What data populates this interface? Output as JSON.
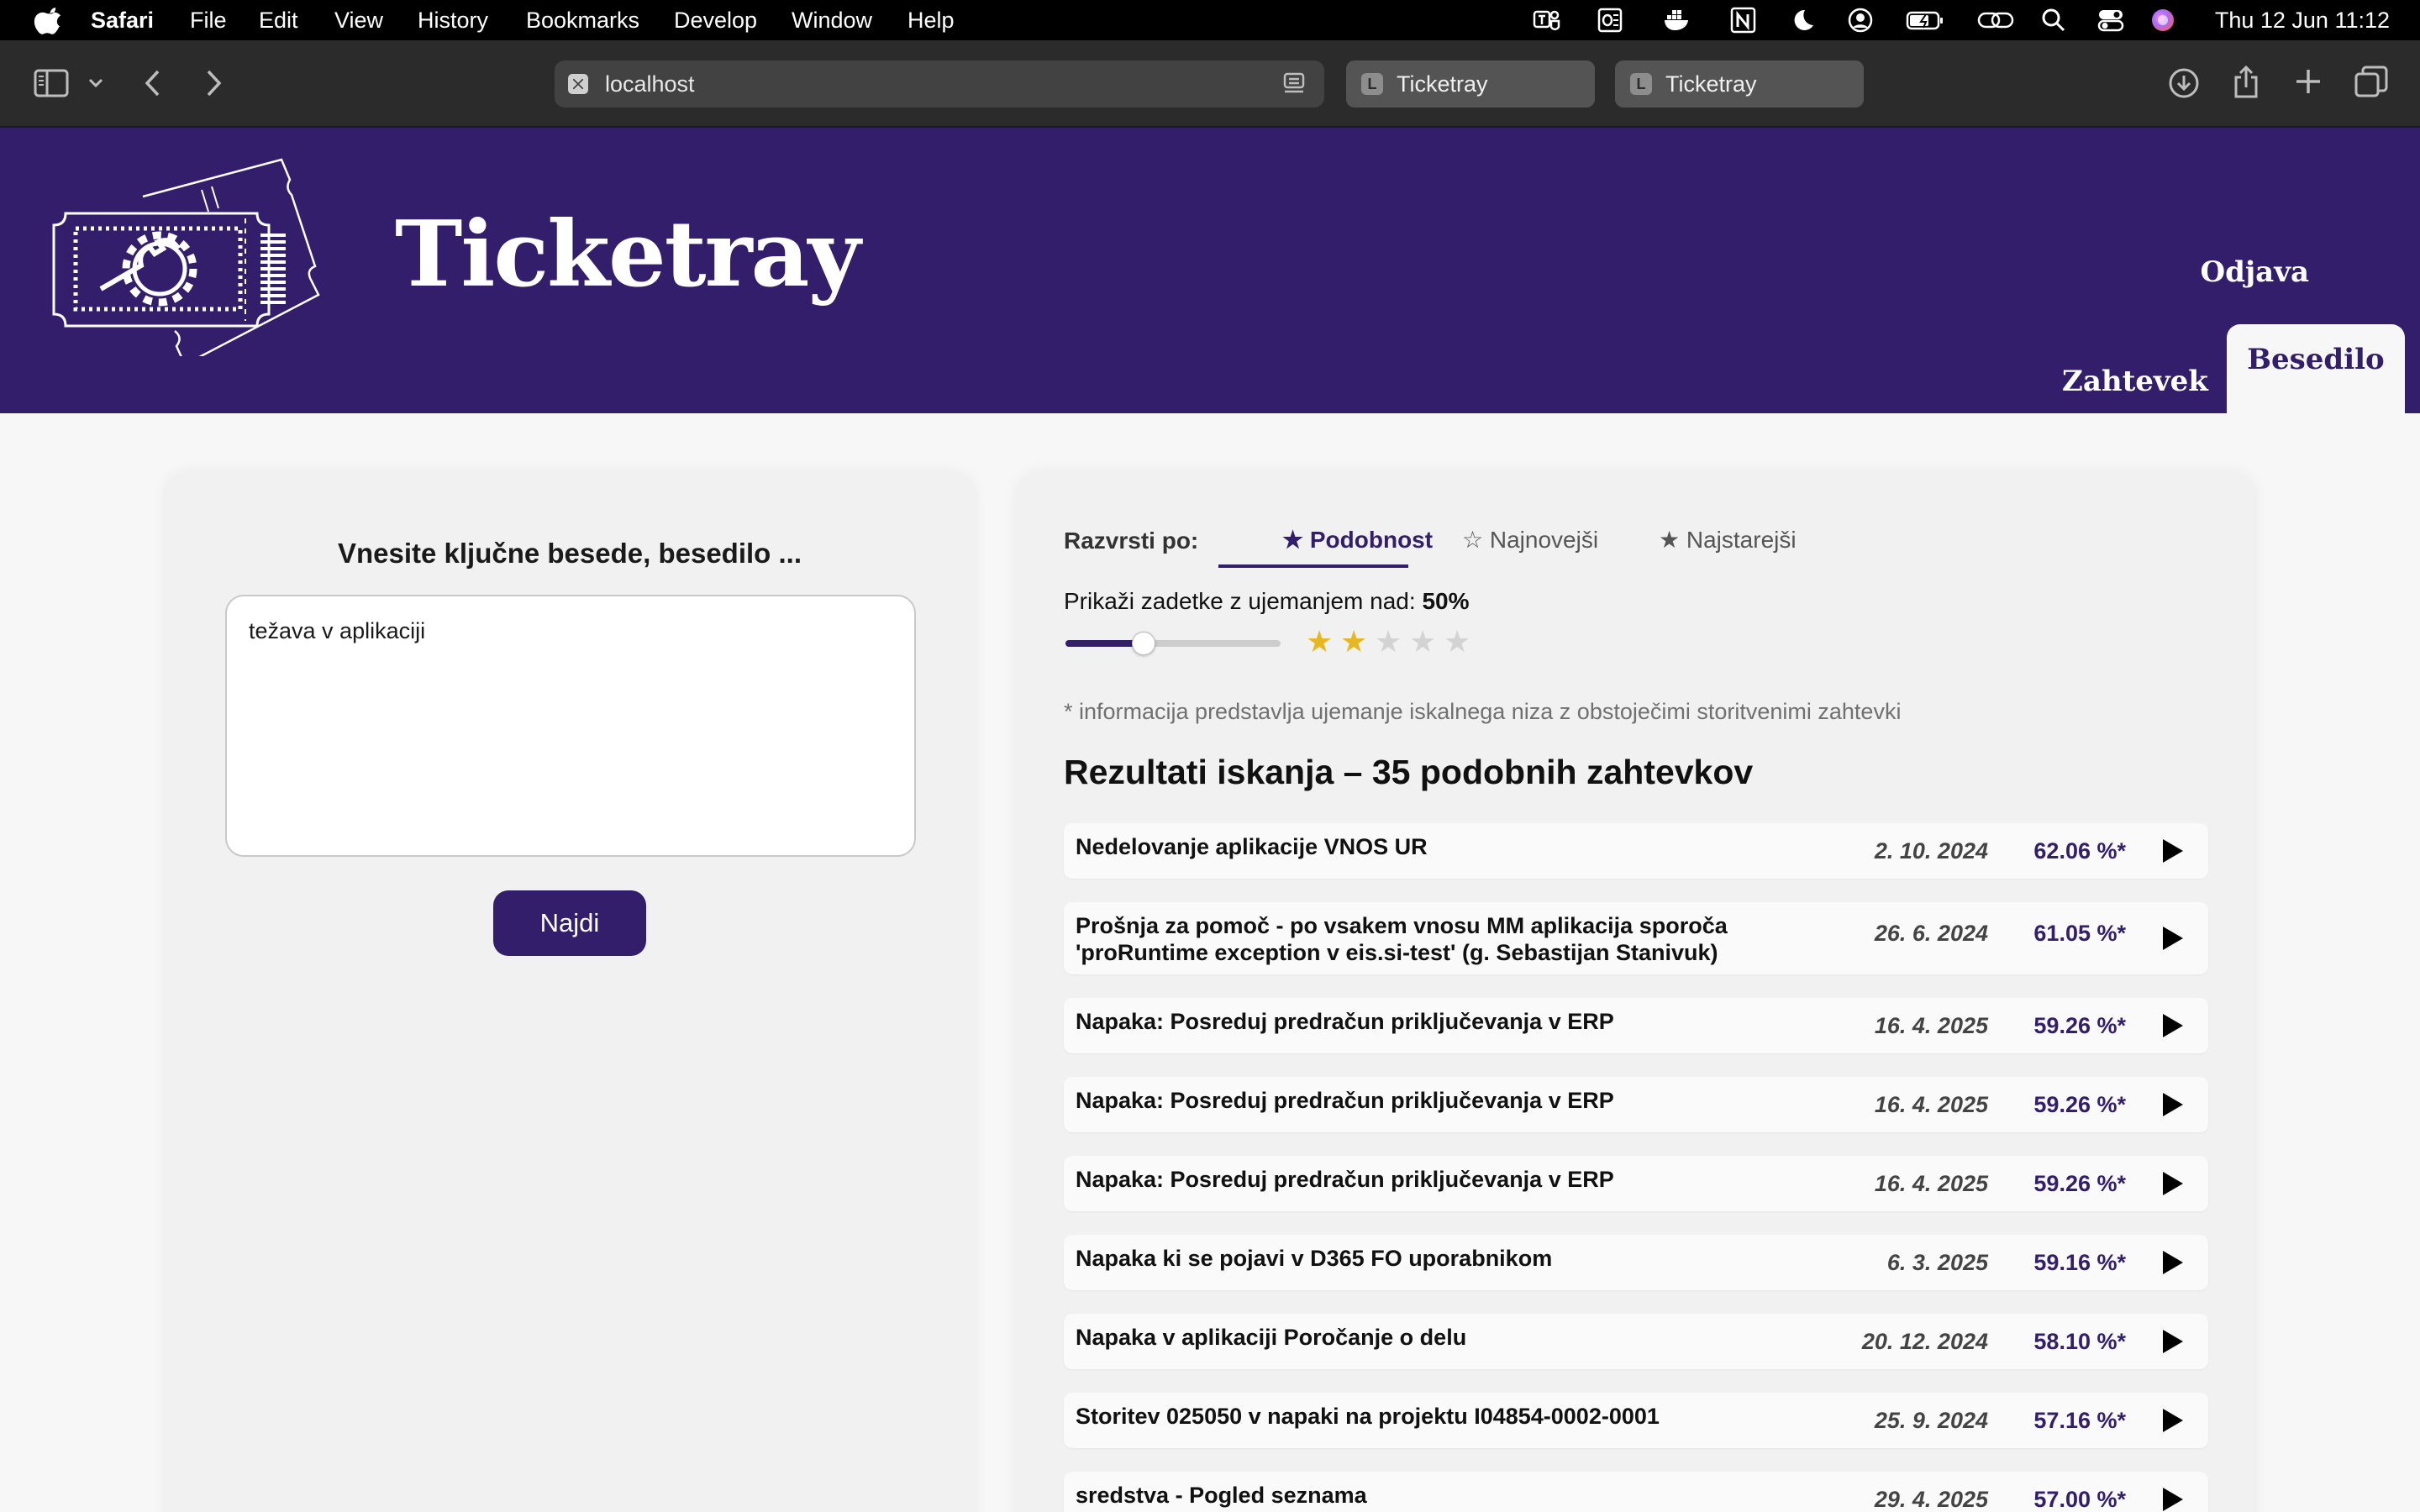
{
  "menubar": {
    "app": "Safari",
    "items": [
      "File",
      "Edit",
      "View",
      "History",
      "Bookmarks",
      "Develop",
      "Window",
      "Help"
    ],
    "clock": "Thu 12 Jun  11:12"
  },
  "browser": {
    "url": "localhost",
    "tabs": [
      {
        "favicon": "L",
        "title": "Ticketray"
      },
      {
        "favicon": "L",
        "title": "Ticketray"
      }
    ]
  },
  "header": {
    "brand": "Ticketray",
    "logout": "Odjava",
    "nav": {
      "zahtevek": "Zahtevek",
      "besedilo": "Besedilo"
    }
  },
  "search": {
    "prompt": "Vnesite ključne besede, besedilo ...",
    "query": "težava v aplikaciji",
    "button": "Najdi"
  },
  "results_panel": {
    "sort_label": "Razvrsti po:",
    "sort_options": [
      "★ Podobnost",
      "☆ Najnovejši",
      "★ Najstarejši"
    ],
    "threshold_label": "Prikaži zadetke z ujemanjem nad:",
    "threshold_value": "50%",
    "threshold_fraction": 0.5,
    "stars_total": 5,
    "stars_filled": 2,
    "info_note": "* informacija predstavlja ujemanje iskalnega niza z obstoječimi storitvenimi zahtevki",
    "title": "Rezultati iskanja – 35 podobnih zahtevkov",
    "results": [
      {
        "title": "Nedelovanje aplikacije VNOS UR",
        "date": "2. 10. 2024",
        "score": "62.06 %*"
      },
      {
        "title": "Prošnja za pomoč - po vsakem vnosu MM aplikacija sporoča 'proRuntime exception v eis.si-test' (g. Sebastijan Stanivuk)",
        "date": "26. 6. 2024",
        "score": "61.05 %*"
      },
      {
        "title": "Napaka: Posreduj predračun priključevanja v ERP",
        "date": "16. 4. 2025",
        "score": "59.26 %*"
      },
      {
        "title": "Napaka: Posreduj predračun priključevanja v ERP",
        "date": "16. 4. 2025",
        "score": "59.26 %*"
      },
      {
        "title": "Napaka: Posreduj predračun priključevanja v ERP",
        "date": "16. 4. 2025",
        "score": "59.26 %*"
      },
      {
        "title": "Napaka ki se pojavi v D365 FO uporabnikom",
        "date": "6. 3. 2025",
        "score": "59.16 %*"
      },
      {
        "title": "Napaka v aplikaciji Poročanje o delu",
        "date": "20. 12. 2024",
        "score": "58.10 %*"
      },
      {
        "title": "Storitev 025050 v napaki na projektu I04854-0002-0001",
        "date": "25. 9. 2024",
        "score": "57.16 %*"
      },
      {
        "title": "sredstva - Pogled seznama",
        "date": "29. 4. 2025",
        "score": "57.00 %*"
      }
    ]
  },
  "colors": {
    "brand": "#321e6b",
    "star_on": "#e5b823",
    "star_off": "#d3d3d3"
  },
  "icons": [
    "apple-icon",
    "sidebar-icon",
    "back-icon",
    "forward-icon",
    "reader-icon",
    "download-icon",
    "share-icon",
    "new-tab-icon",
    "tab-overview-icon",
    "ticket-logo-icon",
    "play-icon"
  ]
}
